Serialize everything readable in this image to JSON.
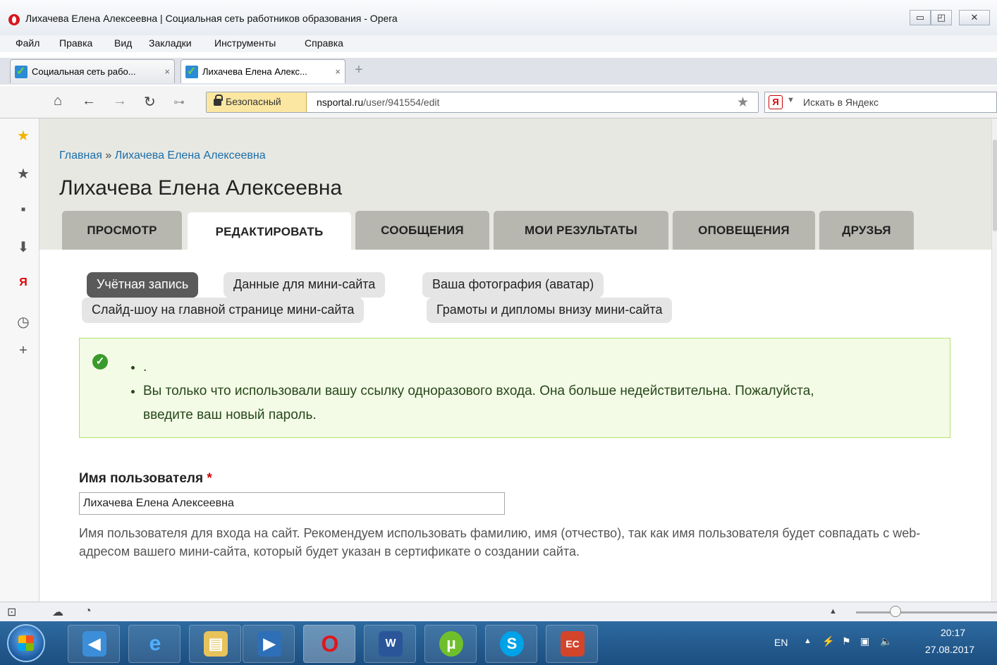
{
  "window": {
    "title": "Лихачева Елена Алексеевна | Социальная сеть работников образования - Opera",
    "controls": {
      "minimize": "▭",
      "maximize": "◰",
      "close": "✕"
    }
  },
  "menu": [
    "Файл",
    "Правка",
    "Вид",
    "Закладки",
    "Инструменты",
    "Справка"
  ],
  "tabs": [
    {
      "label": "Социальная сеть рабо...",
      "close": "×",
      "active": false
    },
    {
      "label": "Лихачева Елена Алекс...",
      "close": "×",
      "active": true
    }
  ],
  "newtab": "+",
  "address": {
    "security_label": "Безопасный",
    "url_host": "nsportal.ru",
    "url_path": "/user/941554/edit",
    "search_placeholder": "Искать в Яндекс",
    "search_engine_logo": "Я",
    "search_engine_arrow": "▼"
  },
  "nav_icons": {
    "home": "home-icon",
    "back": "back-arrow-icon",
    "forward": "forward-arrow-icon",
    "reload": "reload-icon",
    "key": "key-icon",
    "bookmark": "star-icon"
  },
  "sidebar_icons": [
    "star-icon",
    "bookmark-star-icon",
    "notes-icon",
    "downloads-icon",
    "yandex-icon",
    "history-icon",
    "add-icon"
  ],
  "page": {
    "breadcrumb": {
      "home": "Главная",
      "separator": "»",
      "current": "Лихачева Елена Алексеевна"
    },
    "title": "Лихачева Елена Алексеевна",
    "tabs": [
      {
        "label": "ПРОСМОТР",
        "active": false
      },
      {
        "label": "РЕДАКТИРОВАТЬ",
        "active": true
      },
      {
        "label": "СООБЩЕНИЯ",
        "active": false
      },
      {
        "label": "МОИ РЕЗУЛЬТАТЫ",
        "active": false
      },
      {
        "label": "ОПОВЕЩЕНИЯ",
        "active": false
      },
      {
        "label": "ДРУЗЬЯ",
        "active": false
      }
    ],
    "subtabs": [
      {
        "label": "Учётная запись",
        "active": true
      },
      {
        "label": "Данные для мини-сайта",
        "active": false
      },
      {
        "label": "Ваша фотография (аватар)",
        "active": false
      },
      {
        "label": "Слайд-шоу на главной странице мини-сайта",
        "active": false
      },
      {
        "label": "Грамоты и дипломы внизу мини-сайта",
        "active": false
      }
    ],
    "messages": [
      ".",
      "Вы только что использовали вашу ссылку одноразового входа. Она больше недействительна. Пожалуйста, введите ваш новый пароль."
    ],
    "username": {
      "label": "Имя пользователя",
      "required_mark": "*",
      "value": "Лихачева Елена Алексеевна",
      "help": "Имя пользователя для входа на сайт. Рекомендуем использовать фамилию, имя (отчество), так как имя пользователя будет совпадать с web-адресом вашего мини-сайта, который будет указан в сертификате о создании сайта."
    }
  },
  "taskbar": {
    "apps": [
      "volume-app-icon",
      "internet-explorer-icon",
      "file-explorer-icon",
      "media-player-icon",
      "opera-icon",
      "word-icon",
      "utorrent-icon",
      "skype-icon",
      "presentation-icon"
    ],
    "tray": {
      "language": "EN",
      "time": "20:17",
      "date": "27.08.2017"
    }
  },
  "colors": {
    "accent_link": "#1a6ea8",
    "message_bg": "#f3fbe6",
    "message_border": "#b6e06a",
    "required": "#d10000"
  }
}
